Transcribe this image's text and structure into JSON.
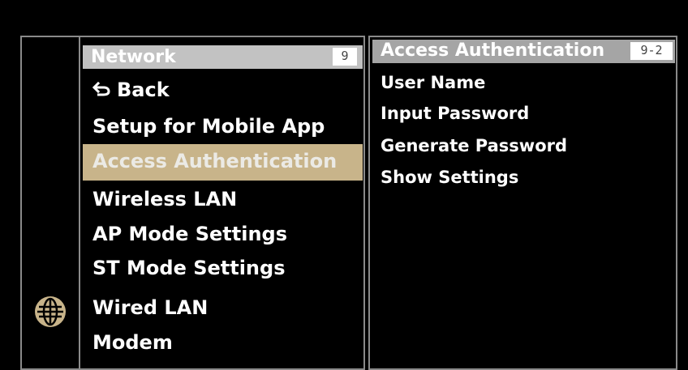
{
  "icons": {
    "category_icon": "globe-icon",
    "back_icon": "back-arrow-icon"
  },
  "colors": {
    "background": "#000000",
    "header_bar": "#c2c2c2",
    "selected_highlight": "#c8b48a",
    "panel_border": "#8a8a8a"
  },
  "menu": {
    "title": "Network",
    "page": "9",
    "items": [
      {
        "label": "Back"
      },
      {
        "label": "Setup for Mobile App"
      },
      {
        "label": "Access Authentication",
        "selected": true
      },
      {
        "label": "Wireless LAN"
      },
      {
        "label": "AP Mode Settings"
      },
      {
        "label": "ST Mode Settings"
      },
      {
        "label": "Wired LAN"
      },
      {
        "label": "Modem"
      }
    ]
  },
  "submenu": {
    "title": "Access Authentication",
    "page": "9-2",
    "items": [
      {
        "label": "User Name"
      },
      {
        "label": "Input Password"
      },
      {
        "label": "Generate Password"
      },
      {
        "label": "Show Settings"
      }
    ]
  }
}
